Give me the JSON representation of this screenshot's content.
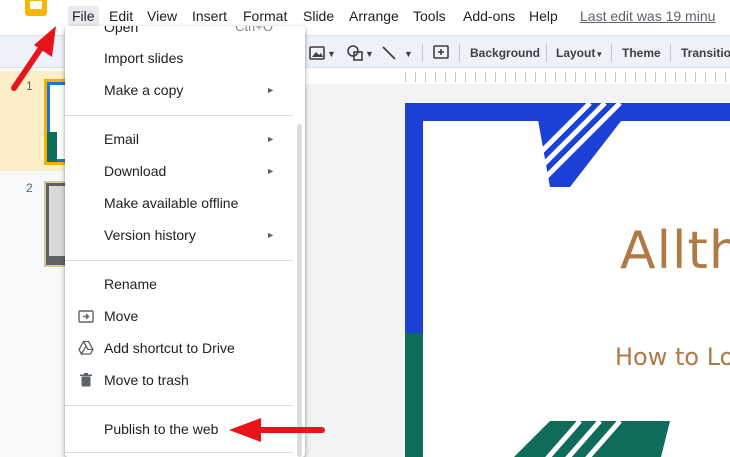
{
  "menubar": {
    "items": [
      {
        "label": "File",
        "active": true
      },
      {
        "label": "Edit"
      },
      {
        "label": "View"
      },
      {
        "label": "Insert"
      },
      {
        "label": "Format"
      },
      {
        "label": "Slide"
      },
      {
        "label": "Arrange"
      },
      {
        "label": "Tools"
      },
      {
        "label": "Add-ons"
      },
      {
        "label": "Help"
      }
    ],
    "last_edit": "Last edit was 19 minu"
  },
  "toolbar": {
    "background_label": "Background",
    "layout_label": "Layout",
    "theme_label": "Theme",
    "transition_label": "Transitio"
  },
  "filmstrip": {
    "slides": [
      {
        "number": "1",
        "selected": true
      },
      {
        "number": "2",
        "selected": false
      }
    ]
  },
  "slide": {
    "title": "Allthi",
    "subtitle": "How to Lo"
  },
  "file_menu": {
    "cut_item": "Open",
    "cut_shortcut": "Ctrl+O",
    "items": [
      {
        "label": "Import slides"
      },
      {
        "label": "Make a copy",
        "submenu": "►"
      },
      {
        "label": "Email",
        "submenu": "►"
      },
      {
        "label": "Download",
        "submenu": "►"
      },
      {
        "label": "Make available offline"
      },
      {
        "label": "Version history",
        "submenu": "►"
      },
      {
        "label": "Rename"
      },
      {
        "label": "Move",
        "icon": "move-folder-icon"
      },
      {
        "label": "Add shortcut to Drive",
        "icon": "drive-shortcut-icon"
      },
      {
        "label": "Move to trash",
        "icon": "trash-icon"
      },
      {
        "label": "Publish to the web"
      }
    ]
  },
  "colors": {
    "accent_yellow": "#f5b800",
    "slide_blue": "#1c3fd6",
    "slide_green": "#0f6b5a",
    "title_brown": "#b07a45",
    "annotation_red": "#e8141b"
  }
}
